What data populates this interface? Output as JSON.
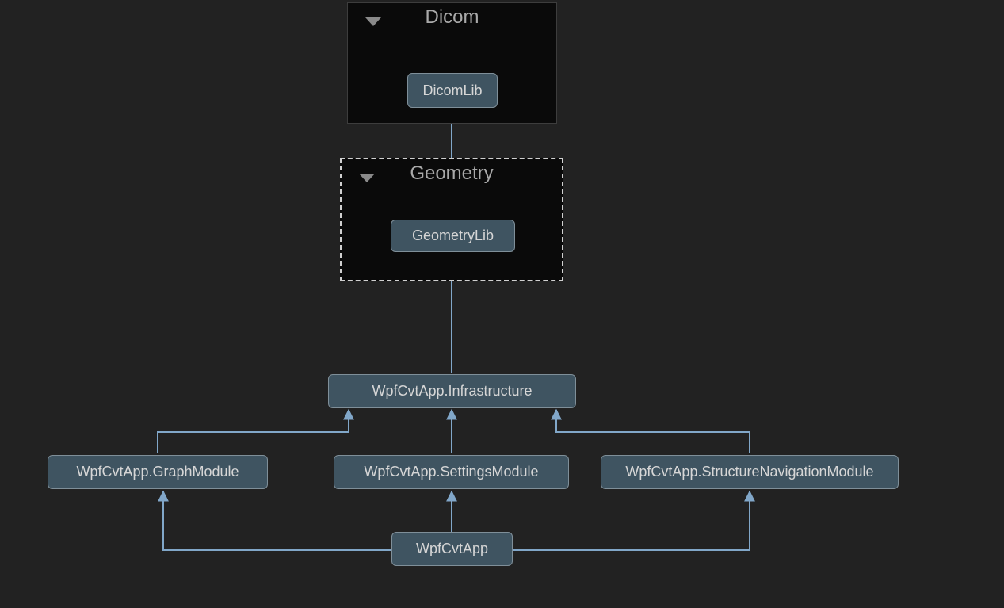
{
  "groups": {
    "dicom": {
      "title": "Dicom",
      "node_label": "DicomLib"
    },
    "geometry": {
      "title": "Geometry",
      "node_label": "GeometryLib"
    }
  },
  "nodes": {
    "infra": {
      "label": "WpfCvtApp.Infrastructure"
    },
    "graph": {
      "label": "WpfCvtApp.GraphModule"
    },
    "settings": {
      "label": "WpfCvtApp.SettingsModule"
    },
    "structnav": {
      "label": "WpfCvtApp.StructureNavigationModule"
    },
    "app": {
      "label": "WpfCvtApp"
    }
  },
  "colors": {
    "edge": "#81a7c9"
  }
}
